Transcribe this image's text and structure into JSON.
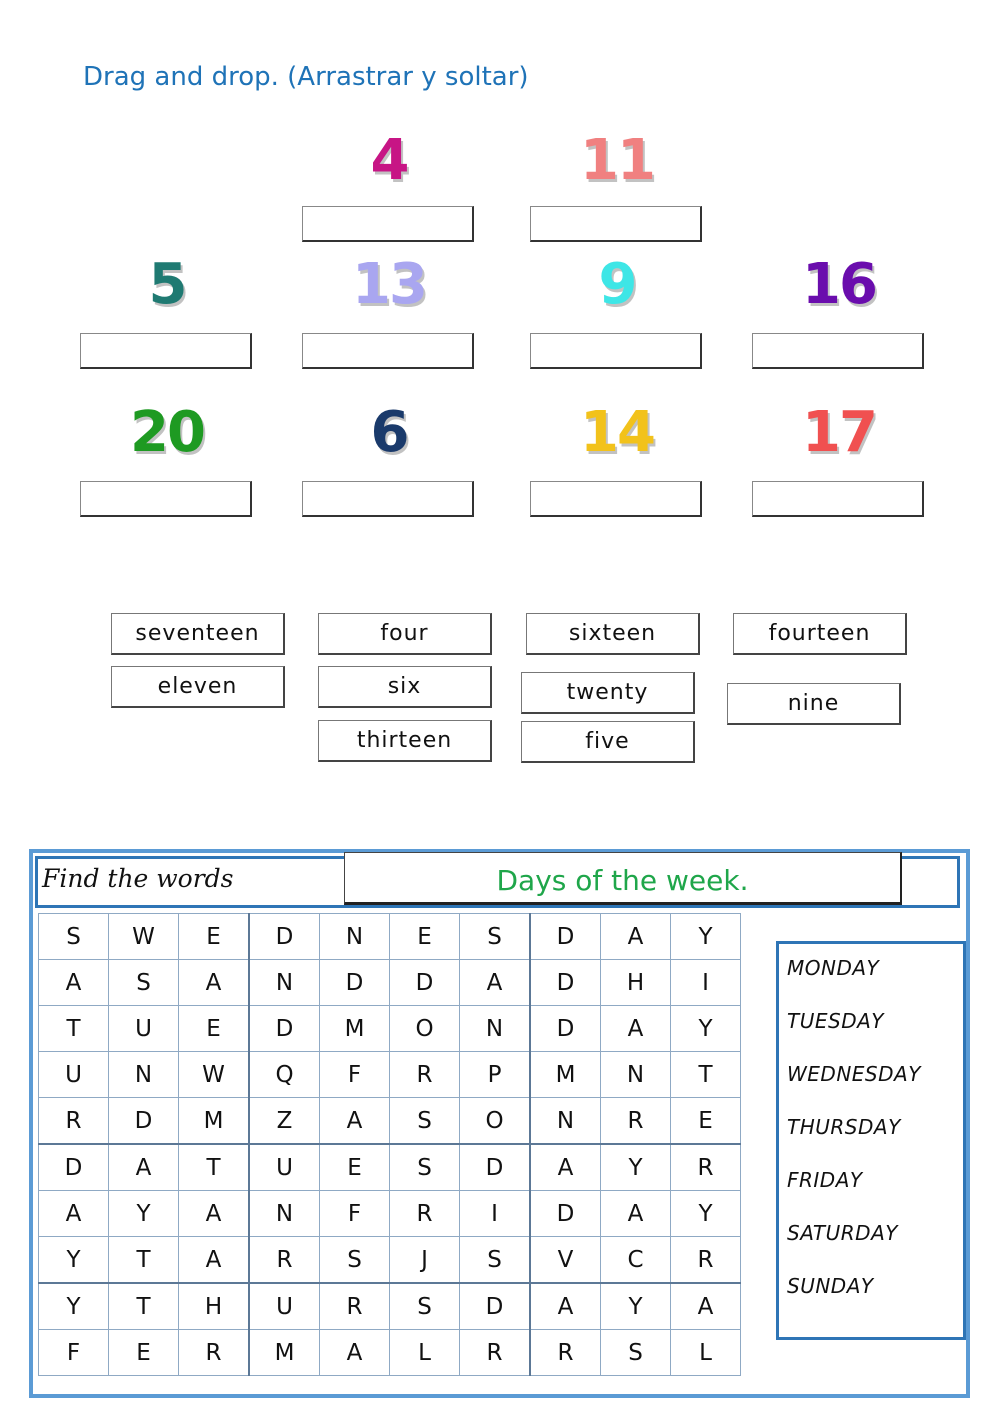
{
  "instruction": "Drag and drop. (Arrastrar y soltar)",
  "numbers": [
    {
      "value": "4",
      "color": "#c71585"
    },
    {
      "value": "11",
      "color": "#f08080"
    },
    {
      "value": "5",
      "color": "#1f7a72"
    },
    {
      "value": "13",
      "color": "#a9a6f0"
    },
    {
      "value": "9",
      "color": "#3ee6e6"
    },
    {
      "value": "16",
      "color": "#6a0dad"
    },
    {
      "value": "20",
      "color": "#1e9a22"
    },
    {
      "value": "6",
      "color": "#1a3a6b"
    },
    {
      "value": "14",
      "color": "#f2c21b"
    },
    {
      "value": "17",
      "color": "#f05050"
    }
  ],
  "word_bank": [
    "seventeen",
    "four",
    "sixteen",
    "fourteen",
    "eleven",
    "six",
    "twenty",
    "nine",
    "thirteen",
    "five"
  ],
  "word_search": {
    "find_label": "Find the words",
    "title": "Days of the week.",
    "grid": [
      [
        "S",
        "W",
        "E",
        "D",
        "N",
        "E",
        "S",
        "D",
        "A",
        "Y"
      ],
      [
        "A",
        "S",
        "A",
        "N",
        "D",
        "D",
        "A",
        "D",
        "H",
        "I"
      ],
      [
        "T",
        "U",
        "E",
        "D",
        "M",
        "O",
        "N",
        "D",
        "A",
        "Y"
      ],
      [
        "U",
        "N",
        "W",
        "Q",
        "F",
        "R",
        "P",
        "M",
        "N",
        "T"
      ],
      [
        "R",
        "D",
        "M",
        "Z",
        "A",
        "S",
        "O",
        "N",
        "R",
        "E"
      ],
      [
        "D",
        "A",
        "T",
        "U",
        "E",
        "S",
        "D",
        "A",
        "Y",
        "R"
      ],
      [
        "A",
        "Y",
        "A",
        "N",
        "F",
        "R",
        "I",
        "D",
        "A",
        "Y"
      ],
      [
        "Y",
        "T",
        "A",
        "R",
        "S",
        "J",
        "S",
        "V",
        "C",
        "R"
      ],
      [
        "Y",
        "T",
        "H",
        "U",
        "R",
        "S",
        "D",
        "A",
        "Y",
        "A"
      ],
      [
        "F",
        "E",
        "R",
        "M",
        "A",
        "L",
        "R",
        "R",
        "S",
        "L"
      ]
    ],
    "words": [
      "MONDAY",
      "TUESDAY",
      "WEDNESDAY",
      "THURSDAY",
      "FRIDAY",
      "SATURDAY",
      "SUNDAY"
    ]
  }
}
